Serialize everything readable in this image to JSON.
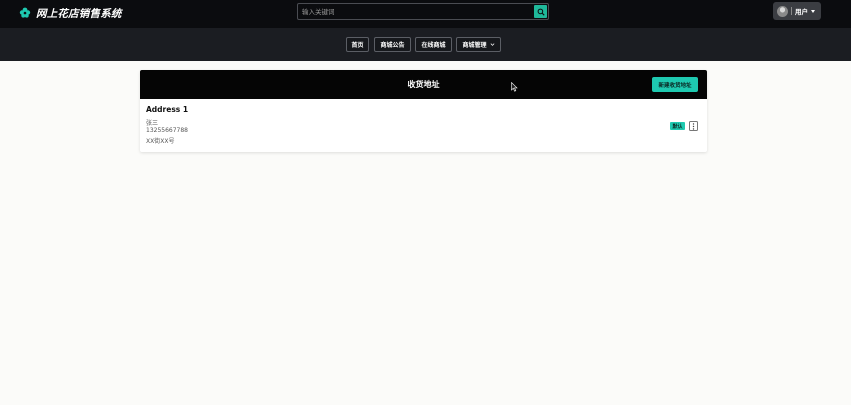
{
  "header": {
    "brand_title": "网上花店销售系统",
    "brand_icon": "flower-icon",
    "search": {
      "placeholder": "输入关键词",
      "value": "",
      "button_icon": "search-icon"
    },
    "user_menu": {
      "label": "用户",
      "avatar_icon": "avatar-icon",
      "caret_icon": "caret-down-icon"
    }
  },
  "nav": {
    "items": [
      {
        "label": "首页"
      },
      {
        "label": "商城公告"
      },
      {
        "label": "在线商城"
      },
      {
        "label": "商城管理",
        "has_dropdown": true,
        "dropdown_icon": "chevron-down-icon"
      }
    ]
  },
  "address_card": {
    "title": "收货地址",
    "new_button_label": "新建收货地址",
    "entry": {
      "name": "Address 1",
      "recipient": "张三",
      "phone": "13255667788",
      "street": "XX街XX号",
      "default_badge": "默认",
      "more_icon": "more-options-icon"
    }
  },
  "colors": {
    "topbar_bg": "#0b0c0f",
    "navbar_bg": "#1b1d22",
    "accent": "#1ec9b0",
    "page_bg": "#fbfbf9",
    "card_header_bg": "#050505"
  }
}
